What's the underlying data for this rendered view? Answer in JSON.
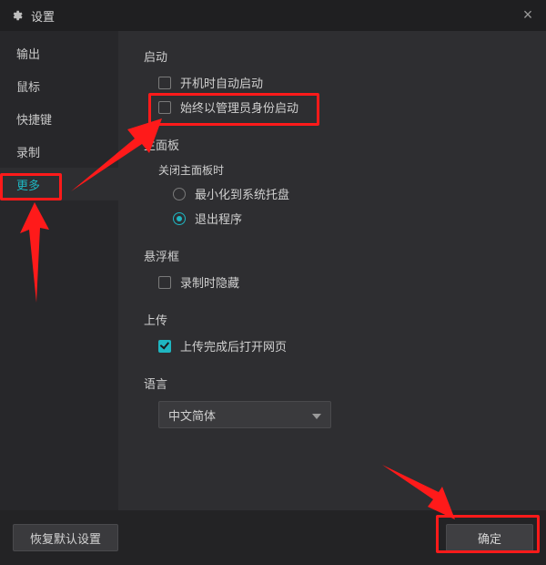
{
  "titlebar": {
    "title": "设置"
  },
  "sidebar": {
    "items": [
      {
        "label": "输出",
        "active": false
      },
      {
        "label": "鼠标",
        "active": false
      },
      {
        "label": "快捷键",
        "active": false
      },
      {
        "label": "录制",
        "active": false
      },
      {
        "label": "更多",
        "active": true
      }
    ]
  },
  "content": {
    "startup": {
      "title": "启动",
      "option_autostart": "开机时自动启动",
      "option_adminstart": "始终以管理员身份启动"
    },
    "mainpanel": {
      "title": "主面板",
      "close_sub": "关闭主面板时",
      "radio_tray": "最小化到系统托盘",
      "radio_exit": "退出程序"
    },
    "floatbox": {
      "title": "悬浮框",
      "option_hide": "录制时隐藏"
    },
    "upload": {
      "title": "上传",
      "option_openweb": "上传完成后打开网页"
    },
    "language": {
      "title": "语言",
      "selected": "中文简体"
    }
  },
  "footer": {
    "restore": "恢复默认设置",
    "ok": "确定"
  }
}
